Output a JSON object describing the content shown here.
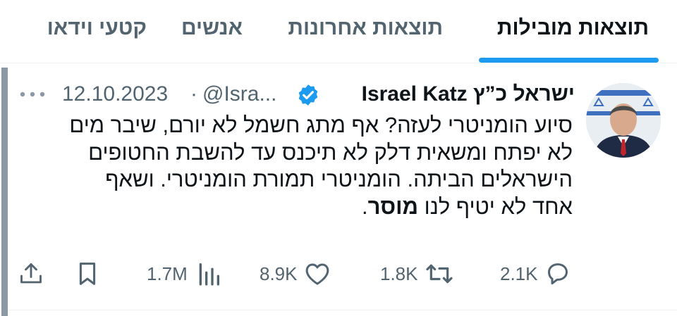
{
  "tabs": [
    {
      "label": "תוצאות מובילות",
      "active": true
    },
    {
      "label": "תוצאות אחרונות",
      "active": false
    },
    {
      "label": "אנשים",
      "active": false
    },
    {
      "label": "קטעי וידאו",
      "active": false
    }
  ],
  "tweet": {
    "author_name": "ישראל כ”ץ Israel Katz",
    "verified": true,
    "handle": "@Isra...",
    "separator": "·",
    "date": "12.10.2023",
    "text_lines": [
      "סיוע הומניטרי לעזה? אף מתג חשמל לא יורם, שיבר מים",
      "לא יפתח ומשאית דלק לא תיכנס עד להשבת החטופים",
      "הישראלים הביתה. הומניטרי תמורת הומניטרי. ושאף",
      "אחד לא יטיף לנו "
    ],
    "text_bold_tail": "מוסר",
    "text_end": ".",
    "stats": {
      "replies": "2.1K",
      "retweets": "1.8K",
      "likes": "8.9K",
      "views": "1.7M"
    }
  },
  "icons": {
    "more": "more-dots-icon",
    "verified": "verified-badge-icon",
    "reply": "reply-icon",
    "retweet": "retweet-icon",
    "like": "heart-icon",
    "views": "views-bar-chart-icon",
    "bookmark": "bookmark-icon",
    "share": "share-icon"
  },
  "colors": {
    "accent": "#1d9bf0",
    "text_primary": "#0f1419",
    "text_secondary": "#536471"
  }
}
